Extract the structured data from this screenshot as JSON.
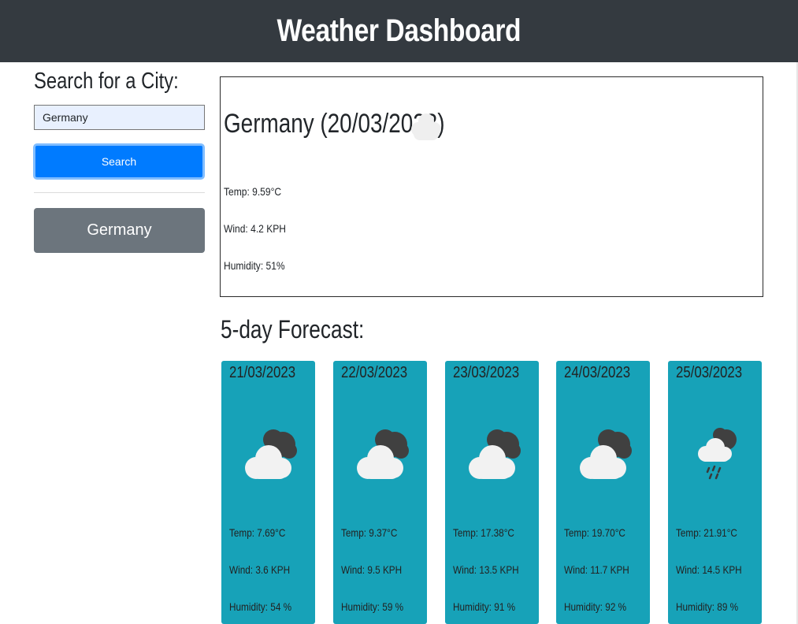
{
  "header": {
    "title": "Weather Dashboard"
  },
  "sidebar": {
    "heading": "Search for a City:",
    "search_value": "Germany",
    "search_button": "Search",
    "history": [
      "Germany"
    ]
  },
  "current": {
    "title": "Germany (20/03/2023)",
    "icon": "cloud-icon",
    "temp": "Temp: 9.59°C",
    "wind": "Wind: 4.2 KPH",
    "humidity": "Humidity: 51%"
  },
  "forecast": {
    "heading": "5-day Forecast:",
    "days": [
      {
        "date": "21/03/2023",
        "icon": "broken-clouds-icon",
        "temp": "Temp: 7.69°C",
        "wind": "Wind: 3.6 KPH",
        "humidity": "Humidity: 54 %"
      },
      {
        "date": "22/03/2023",
        "icon": "broken-clouds-icon",
        "temp": "Temp: 9.37°C",
        "wind": "Wind: 9.5 KPH",
        "humidity": "Humidity: 59 %"
      },
      {
        "date": "23/03/2023",
        "icon": "broken-clouds-icon",
        "temp": "Temp: 17.38°C",
        "wind": "Wind: 13.5 KPH",
        "humidity": "Humidity: 91 %"
      },
      {
        "date": "24/03/2023",
        "icon": "broken-clouds-icon",
        "temp": "Temp: 19.70°C",
        "wind": "Wind: 11.7 KPH",
        "humidity": "Humidity: 92 %"
      },
      {
        "date": "25/03/2023",
        "icon": "rain-icon",
        "temp": "Temp: 21.91°C",
        "wind": "Wind: 14.5 KPH",
        "humidity": "Humidity: 89 %"
      }
    ]
  },
  "colors": {
    "header_bg": "#343a40",
    "search_button": "#007bff",
    "history_button": "#6c757d",
    "forecast_card": "#17a2b8"
  }
}
